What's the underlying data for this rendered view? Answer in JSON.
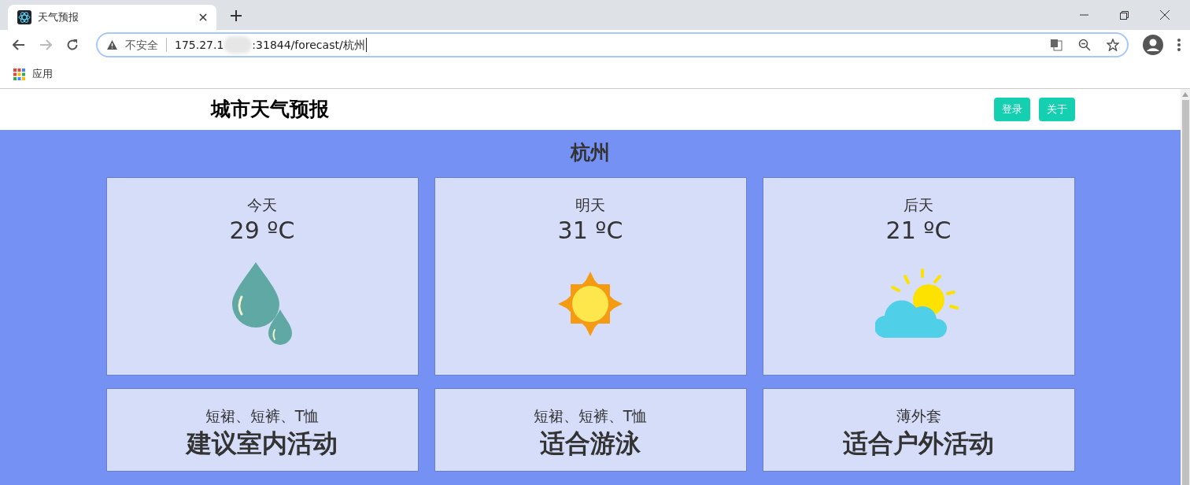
{
  "browser": {
    "tab": {
      "title": "天气预报"
    },
    "address": {
      "security": "不安全",
      "url_start": "175.27.1",
      "url_end": ":31844/forecast/杭州"
    },
    "bookmarks": [
      {
        "label": "应用"
      }
    ]
  },
  "header": {
    "title": "城市天气预报",
    "buttons": [
      "登录",
      "关于"
    ]
  },
  "city": "杭州",
  "forecast": [
    {
      "day": "今天",
      "temperature": "29 ºC",
      "kind": "rain"
    },
    {
      "day": "明天",
      "temperature": "31 ºC",
      "kind": "sunny"
    },
    {
      "day": "后天",
      "temperature": "21 ºC",
      "kind": "partly-cloudy"
    }
  ],
  "advice": [
    {
      "clothing": "短裙、短裤、T恤",
      "activity": "建议室内活动"
    },
    {
      "clothing": "短裙、短裤、T恤",
      "activity": "适合游泳"
    },
    {
      "clothing": "薄外套",
      "activity": "适合户外活动"
    }
  ]
}
